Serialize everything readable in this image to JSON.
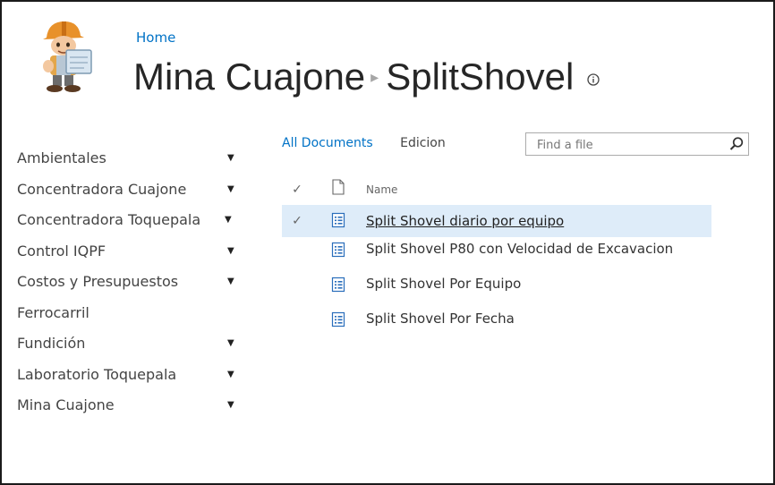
{
  "breadcrumb": {
    "home_label": "Home"
  },
  "title": {
    "site": "Mina Cuajone",
    "library": "SplitShovel"
  },
  "leftnav": {
    "items": [
      {
        "label": "Ambientales",
        "has_submenu": true
      },
      {
        "label": "Concentradora Cuajone",
        "has_submenu": true
      },
      {
        "label": "Concentradora Toquepala",
        "has_submenu": true
      },
      {
        "label": "Control IQPF",
        "has_submenu": true
      },
      {
        "label": "Costos y Presupuestos",
        "has_submenu": true
      },
      {
        "label": "Ferrocarril",
        "has_submenu": false
      },
      {
        "label": "Fundición",
        "has_submenu": true
      },
      {
        "label": "Laboratorio Toquepala",
        "has_submenu": true
      },
      {
        "label": "Mina Cuajone",
        "has_submenu": true
      }
    ]
  },
  "views": {
    "all_documents": "All Documents",
    "edicion": "Edicion"
  },
  "search": {
    "placeholder": "Find a file"
  },
  "list": {
    "header_name": "Name",
    "items": [
      {
        "name": "Split Shovel diario por equipo",
        "selected": true
      },
      {
        "name": "Split Shovel P80 con Velocidad de Excavacion",
        "selected": false
      },
      {
        "name": "Split Shovel Por Equipo",
        "selected": false
      },
      {
        "name": "Split Shovel Por Fecha",
        "selected": false
      }
    ]
  },
  "colors": {
    "link": "#0072c6",
    "selected_row": "#deecf9",
    "border": "#1a1a1a"
  },
  "icons": {
    "logo": "construction-worker-logo",
    "info": "info-icon",
    "search": "search-icon",
    "document": "document-icon",
    "list_document": "list-document-icon",
    "check": "check-icon",
    "submenu": "triangle-down-icon"
  }
}
